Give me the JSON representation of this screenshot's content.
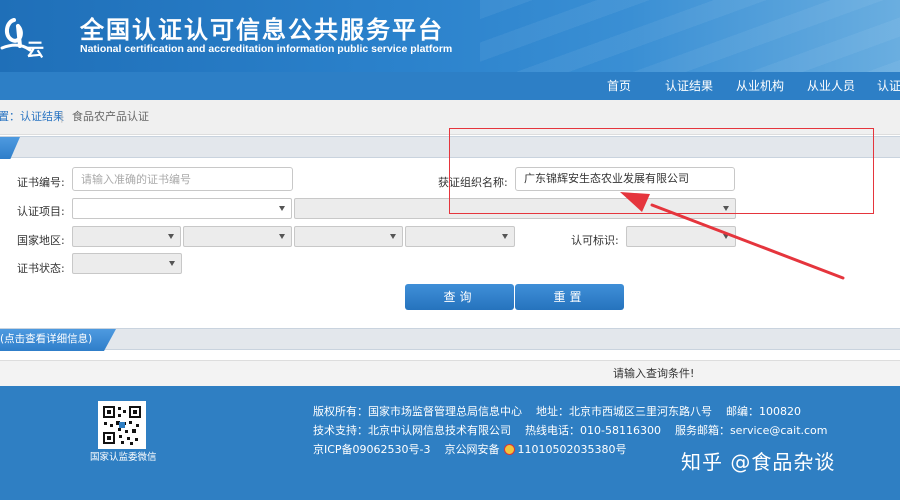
{
  "header": {
    "title": "全国认证认可信息公共服务平台",
    "subtitle": "National certification and accreditation information public service platform",
    "logo_text": "云"
  },
  "nav": {
    "items": [
      {
        "label": "首页"
      },
      {
        "label": "认证结果"
      },
      {
        "label": "从业机构"
      },
      {
        "label": "从业人员"
      },
      {
        "label": "认证"
      }
    ]
  },
  "breadcrumb": {
    "parent": "置：认证结果",
    "current": "食品农产品认证"
  },
  "form": {
    "cert_no_label": "证书编号:",
    "cert_no_placeholder": "请输入准确的证书编号",
    "org_label": "获证组织名称:",
    "org_value": "广东锦辉安生态农业发展有限公司",
    "project_label": "认证项目:",
    "region_label": "国家地区:",
    "accredit_label": "认可标识:",
    "status_label": "证书状态:",
    "search_button": "查询",
    "reset_button": "重置"
  },
  "detail_strip": {
    "label": "(点击查看详细信息)"
  },
  "results": {
    "message": "请输入查询条件!"
  },
  "footer": {
    "qr_caption": "国家认监委微信",
    "copyright_label": "版权所有：国家市场监督管理总局信息中心",
    "address": "地址：北京市西城区三里河东路八号",
    "postcode": "邮编：100820",
    "tech_support": "技术支持：北京中认网信息技术有限公司",
    "hotline": "热线电话：010-58116300",
    "service_email": "服务邮箱：service@cait.com",
    "icp": "京ICP备09062530号-3",
    "police_record": "京公网安备",
    "police_no": "11010502035380号"
  },
  "watermark": "知乎 @食品杂谈",
  "colors": {
    "brand_blue": "#2d7fc6",
    "annotation_red": "#e5353d"
  },
  "icons": [
    "logo-icon",
    "qr-code-icon",
    "police-badge-icon",
    "dropdown-caret-icon"
  ]
}
